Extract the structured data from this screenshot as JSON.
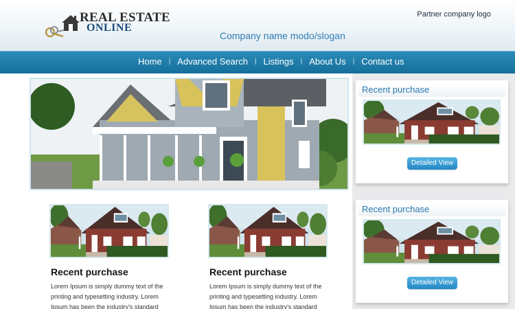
{
  "header": {
    "logo": {
      "line1": "REAL ESTATE",
      "line2": "ONLINE"
    },
    "partner_logo": "Partner company logo",
    "slogan": "Company name modo/slogan"
  },
  "nav": {
    "items": [
      {
        "label": "Home"
      },
      {
        "label": "Advanced Search"
      },
      {
        "label": "Listings"
      },
      {
        "label": "About Us"
      },
      {
        "label": "Contact us"
      }
    ],
    "separator": "|"
  },
  "main": {
    "cards": [
      {
        "title": "Recent purchase",
        "text": "Lorem Ipsum is simply dummy text of the printing and typesetting industry. Lorem Ipsum has been the industry's standard"
      },
      {
        "title": "Recent purchase",
        "text": "Lorem Ipsum is simply dummy text of the printing and typesetting industry. Lorem Ipsum has been the industry's standard"
      }
    ]
  },
  "sidebar": {
    "panels": [
      {
        "title": "Recent purchase",
        "button": "Detailed View"
      },
      {
        "title": "Recent purchase",
        "button": "Detailed View"
      }
    ]
  },
  "colors": {
    "nav_bg": "#1f7eab",
    "accent_blue": "#2879b0",
    "button_blue": "#2388c6",
    "sidebar_bg": "#e9eaeb"
  }
}
